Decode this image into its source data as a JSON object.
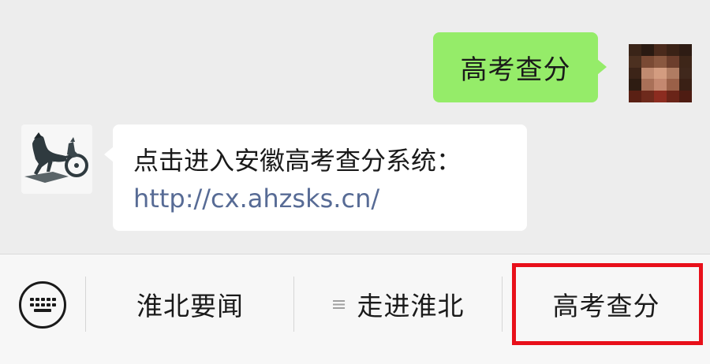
{
  "chat": {
    "outgoing_message": "高考查分",
    "incoming_message": {
      "text": "点击进入安徽高考查分系统：",
      "link": "http://cx.ahzsks.cn/"
    }
  },
  "menu": {
    "keyboard_icon": "keyboard-icon",
    "items": [
      {
        "label": "淮北要闻",
        "icon": ""
      },
      {
        "label": "走进淮北",
        "icon": "≡"
      },
      {
        "label": "高考查分",
        "icon": ""
      }
    ],
    "highlight_color": "#e8101a"
  },
  "colors": {
    "outgoing_bubble": "#95ec69",
    "link": "#576b95"
  }
}
